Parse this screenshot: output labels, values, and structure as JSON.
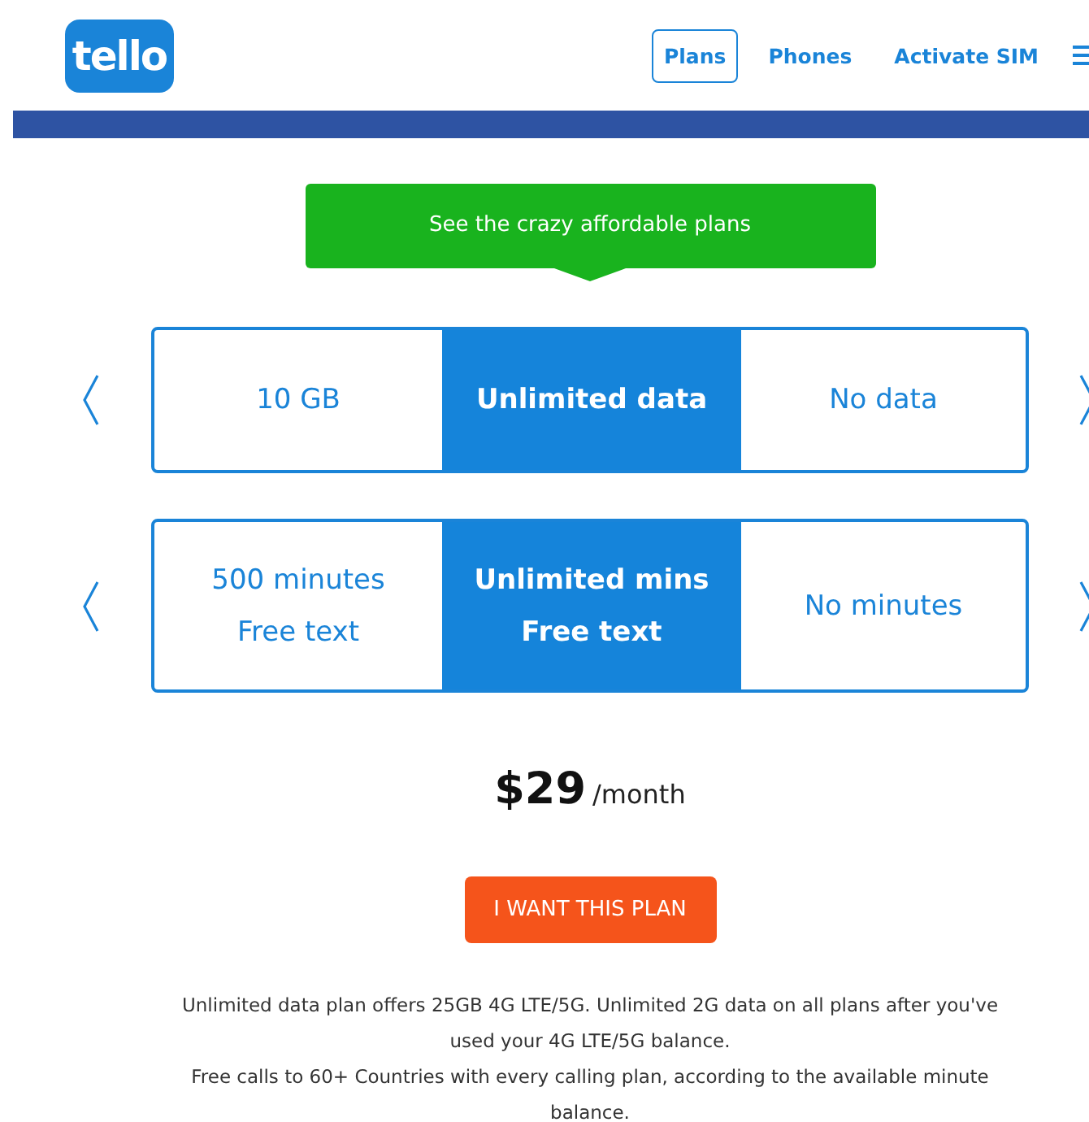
{
  "header": {
    "logo": "tello",
    "nav": [
      {
        "label": "Plans",
        "selected": true
      },
      {
        "label": "Phones",
        "selected": false
      },
      {
        "label": "Activate SIM",
        "selected": false
      }
    ]
  },
  "banner": "See the crazy affordable plans",
  "selectors": [
    {
      "options": [
        {
          "lines": [
            "10 GB"
          ],
          "selected": false
        },
        {
          "lines": [
            "Unlimited data"
          ],
          "selected": true
        },
        {
          "lines": [
            "No data"
          ],
          "selected": false
        }
      ]
    },
    {
      "options": [
        {
          "lines": [
            "500 minutes",
            "Free text"
          ],
          "selected": false
        },
        {
          "lines": [
            "Unlimited mins",
            "Free text"
          ],
          "selected": true
        },
        {
          "lines": [
            "No minutes"
          ],
          "selected": false
        }
      ]
    }
  ],
  "price": {
    "amount": "$29",
    "period": "/month"
  },
  "cta": "I WANT THIS PLAN",
  "notes": [
    "Unlimited data plan offers 25GB 4G LTE/5G. Unlimited 2G data on all plans after you've used your 4G LTE/5G balance.",
    "Free calls to 60+ Countries with every calling plan, according to the available minute balance."
  ]
}
